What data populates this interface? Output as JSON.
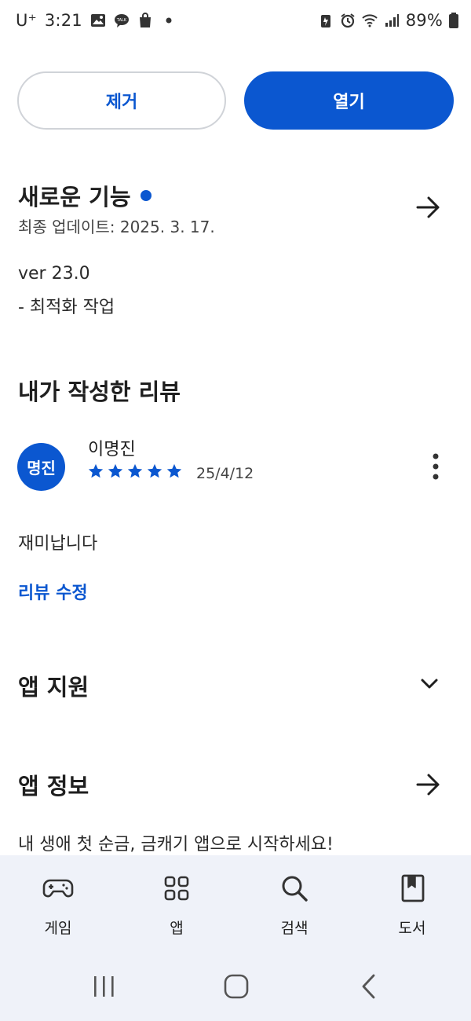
{
  "status_bar": {
    "carrier": "U⁺",
    "time": "3:21",
    "battery": "89%"
  },
  "actions": {
    "remove_label": "제거",
    "open_label": "열기"
  },
  "whats_new": {
    "title": "새로운 기능",
    "last_updated": "최종 업데이트: 2025. 3. 17.",
    "version": "ver 23.0",
    "notes": "- 최적화 작업"
  },
  "my_review": {
    "title": "내가 작성한 리뷰",
    "avatar_text": "명진",
    "reviewer_name": "이명진",
    "rating": 5,
    "date": "25/4/12",
    "text": "재미납니다",
    "edit_label": "리뷰 수정"
  },
  "app_support": {
    "title": "앱 지원"
  },
  "app_info": {
    "title": "앱 정보",
    "description": "내 생애 첫 순금, 금캐기 앱으로 시작하세요!"
  },
  "bottom_nav": {
    "items": [
      {
        "label": "게임",
        "icon": "gamepad-icon"
      },
      {
        "label": "앱",
        "icon": "apps-grid-icon"
      },
      {
        "label": "검색",
        "icon": "search-icon"
      },
      {
        "label": "도서",
        "icon": "book-icon"
      }
    ]
  },
  "colors": {
    "accent": "#0b57d0",
    "nav_background": "#eff2f9"
  }
}
